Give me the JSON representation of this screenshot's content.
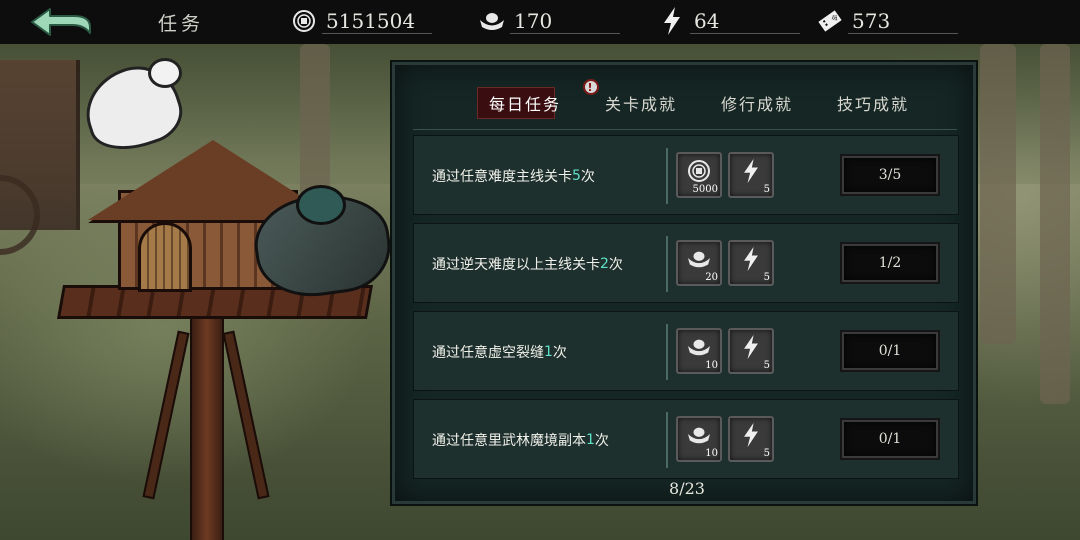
{
  "header": {
    "title": "任务",
    "currencies": [
      {
        "icon": "coin-icon",
        "value": "5151504"
      },
      {
        "icon": "silver-ingot-icon",
        "value": "170"
      },
      {
        "icon": "lightning-icon",
        "value": "64"
      },
      {
        "icon": "ticket-icon",
        "value": "573"
      }
    ]
  },
  "tabs": [
    {
      "label": "每日任务",
      "active": true
    },
    {
      "label": "关卡成就",
      "alert": "!"
    },
    {
      "label": "修行成就"
    },
    {
      "label": "技巧成就"
    }
  ],
  "quests": [
    {
      "text_before": "通过任意难度主线关卡",
      "count": "5",
      "text_after": "次",
      "rewards": [
        {
          "icon": "coin-icon",
          "qty": "5000"
        },
        {
          "icon": "lightning-icon",
          "qty": "5"
        }
      ],
      "progress": "3/5"
    },
    {
      "text_before": "通过逆天难度以上主线关卡",
      "count": "2",
      "text_after": "次",
      "rewards": [
        {
          "icon": "silver-ingot-icon",
          "qty": "20"
        },
        {
          "icon": "lightning-icon",
          "qty": "5"
        }
      ],
      "progress": "1/2"
    },
    {
      "text_before": "通过任意虚空裂缝",
      "count": "1",
      "text_after": "次",
      "rewards": [
        {
          "icon": "silver-ingot-icon",
          "qty": "10"
        },
        {
          "icon": "lightning-icon",
          "qty": "5"
        }
      ],
      "progress": "0/1"
    },
    {
      "text_before": "通过任意里武林魔境副本",
      "count": "1",
      "text_after": "次",
      "rewards": [
        {
          "icon": "silver-ingot-icon",
          "qty": "10"
        },
        {
          "icon": "lightning-icon",
          "qty": "5"
        }
      ],
      "progress": "0/1"
    }
  ],
  "pager": "8/23",
  "colors": {
    "accent": "#5fe0c8",
    "panel": "#152624",
    "active_tab": "#3a0e10"
  }
}
